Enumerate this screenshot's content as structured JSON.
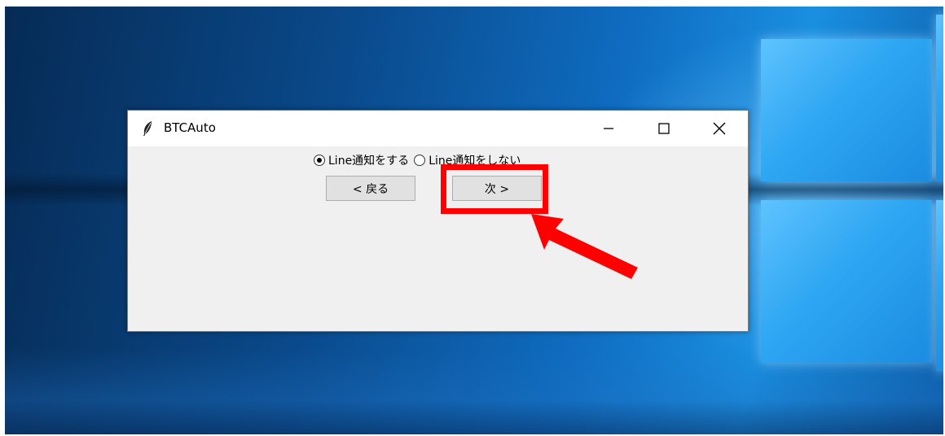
{
  "window": {
    "title": "BTCAuto",
    "controls": {
      "minimize_icon": "minimize-icon",
      "maximize_icon": "maximize-icon",
      "close_icon": "close-icon"
    }
  },
  "notification_options": {
    "option_on": {
      "label": "Line通知をする",
      "selected": true
    },
    "option_off": {
      "label": "Line通知をしない",
      "selected": false
    }
  },
  "buttons": {
    "back_label": "< 戻る",
    "next_label": "次 >"
  },
  "annotation": {
    "highlight_color": "#ff0000",
    "target": "next-button"
  }
}
